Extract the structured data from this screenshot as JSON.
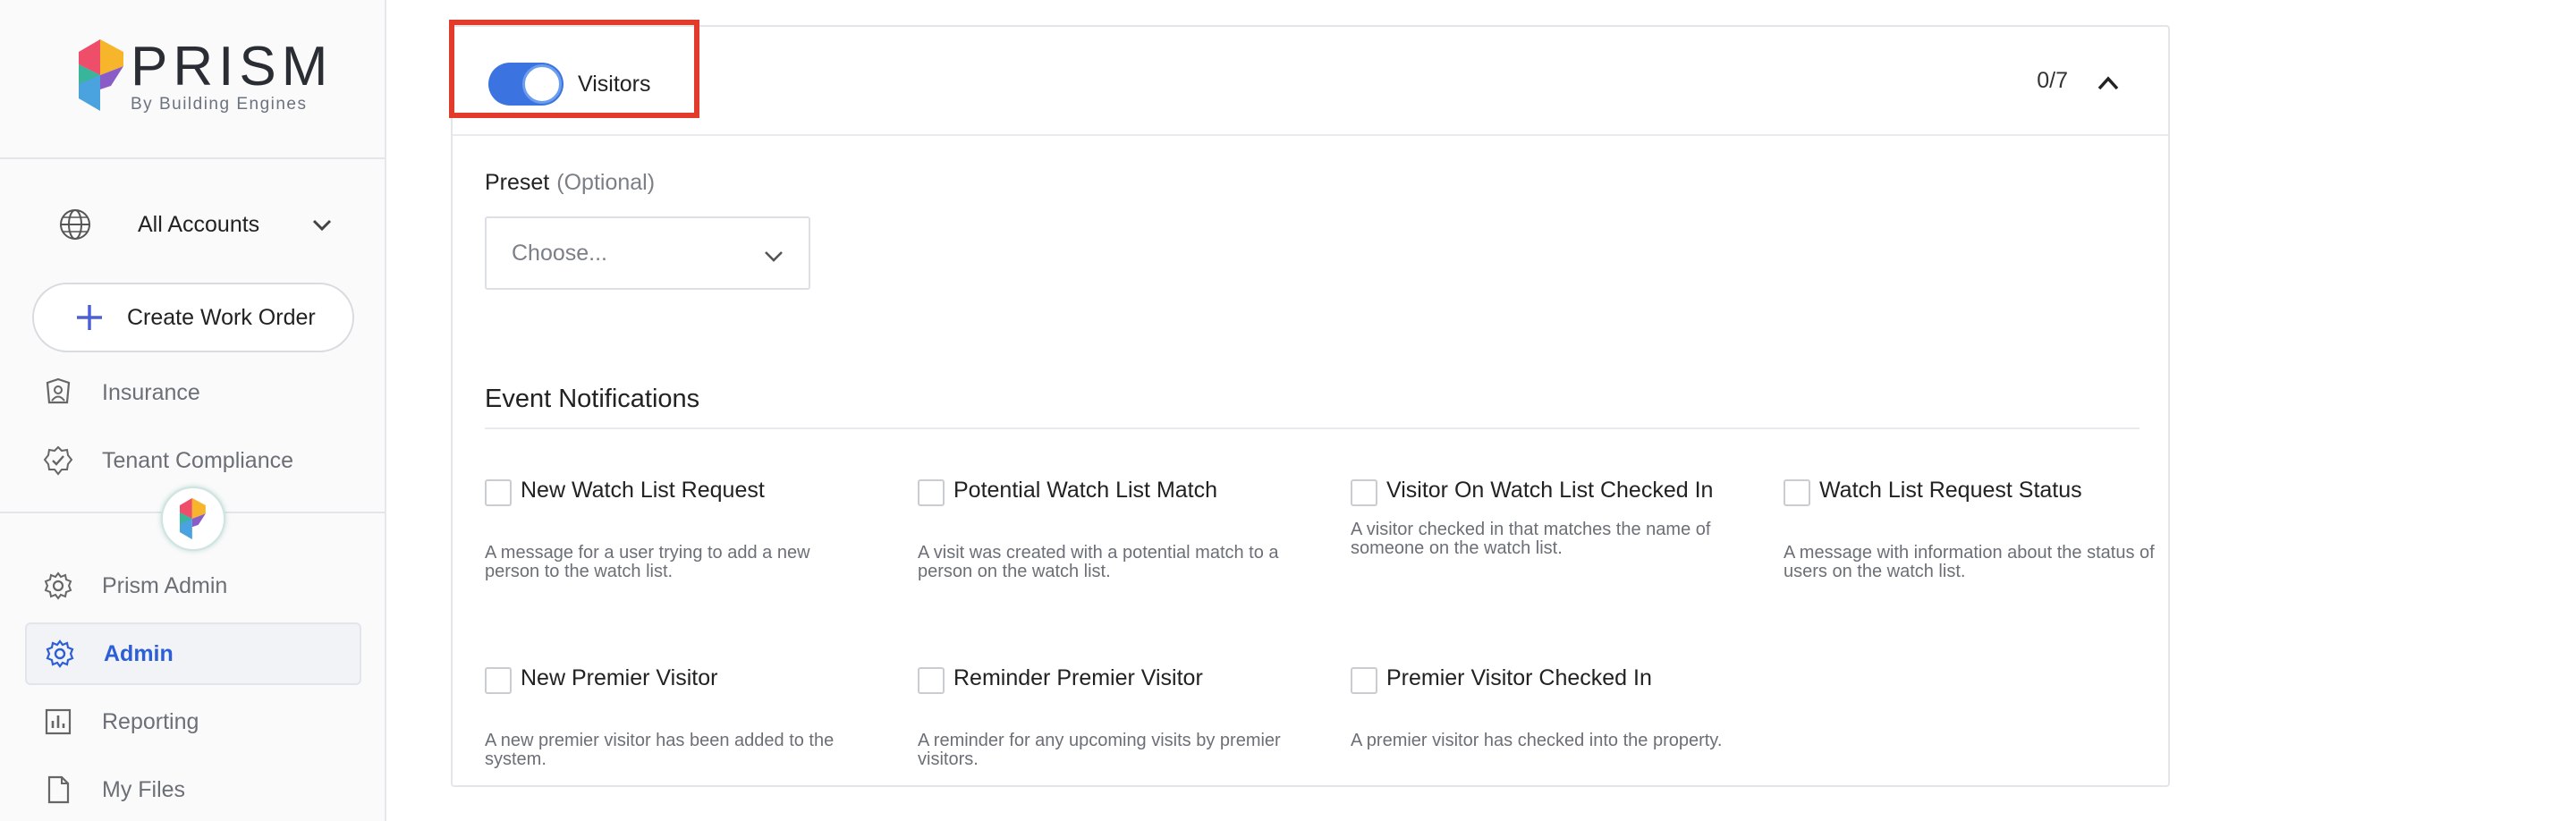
{
  "brand": {
    "name": "PRISM",
    "tagline": "By Building Engines"
  },
  "sidebar": {
    "account_label": "All Accounts",
    "create_button": "Create Work Order",
    "items": [
      {
        "label": "Insurance",
        "icon": "shield-person-icon"
      },
      {
        "label": "Tenant Compliance",
        "icon": "badge-check-icon"
      },
      {
        "label": "Prism Admin",
        "icon": "gear-icon"
      },
      {
        "label": "Admin",
        "icon": "gear-icon",
        "active": true
      },
      {
        "label": "Reporting",
        "icon": "bar-chart-icon"
      },
      {
        "label": "My Files",
        "icon": "file-icon"
      }
    ]
  },
  "panel": {
    "toggle_label": "Visitors",
    "toggle_on": true,
    "count": "0/7",
    "preset_label": "Preset",
    "preset_optional": "(Optional)",
    "preset_placeholder": "Choose...",
    "section_title": "Event Notifications",
    "notifications": [
      {
        "title": "New Watch List Request",
        "desc": "A message for a user trying to add a new person to the watch list."
      },
      {
        "title": "Potential Watch List Match",
        "desc": "A visit was created with a potential match to a person on the watch list."
      },
      {
        "title": "Visitor On Watch List Checked In",
        "desc": "A visitor checked in that matches the name of someone on the watch list."
      },
      {
        "title": "Watch List Request Status",
        "desc": "A message with information about the status of users on the watch list."
      },
      {
        "title": "New Premier Visitor",
        "desc": "A new premier visitor has been added to the system."
      },
      {
        "title": "Reminder Premier Visitor",
        "desc": "A reminder for any upcoming visits by premier visitors."
      },
      {
        "title": "Premier Visitor Checked In",
        "desc": "A premier visitor has checked into the property."
      }
    ]
  },
  "colors": {
    "accent": "#3b74e0",
    "active_text": "#2c5ed6",
    "highlight": "#e23a2b"
  }
}
